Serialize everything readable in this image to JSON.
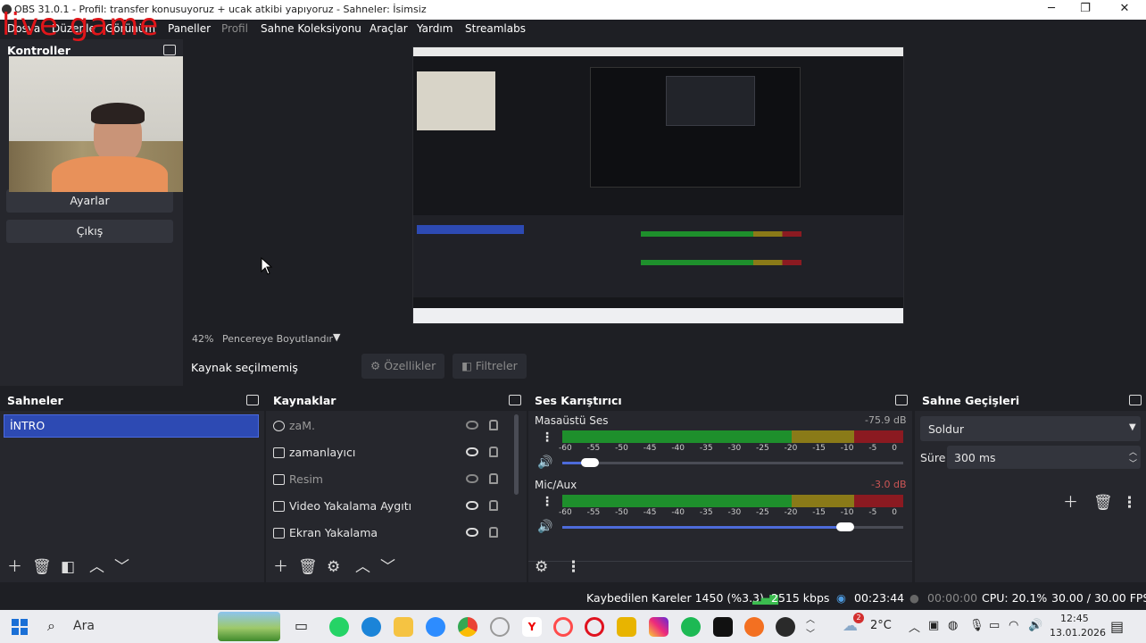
{
  "window": {
    "title": "OBS 31.0.1 - Profil: transfer  konusuyoruz + ucak atkibi yapıyoruz - Sahneler: İsimsiz",
    "minimize": "─",
    "maximize": "❐",
    "close": "✕"
  },
  "menu": {
    "items": [
      "Dosya",
      "Düzenle",
      "Görünüm",
      "Paneller",
      "Profil",
      "Sahne Koleksiyonu",
      "Araçlar",
      "Yardım",
      "Streamlabs"
    ]
  },
  "overlay_text": "live game",
  "controls": {
    "title": "Kontroller",
    "settings_label": "Ayarlar",
    "exit_label": "Çıkış"
  },
  "preview": {
    "zoom": "42%",
    "fit_label": "Pencereye Boyutlandır"
  },
  "props": {
    "no_source": "Kaynak seçilmemiş",
    "properties_label": "Özellikler",
    "filters_label": "Filtreler"
  },
  "scenes": {
    "title": "Sahneler",
    "items": [
      "İNTRO"
    ]
  },
  "sources": {
    "title": "Kaynaklar",
    "items": [
      {
        "label": "zaM.",
        "icon": "clock-icon",
        "visible": false
      },
      {
        "label": "zamanlayıcı",
        "icon": "text-icon",
        "visible": true
      },
      {
        "label": "Resim",
        "icon": "image-icon",
        "visible": false
      },
      {
        "label": "Video Yakalama Aygıtı",
        "icon": "camera-icon",
        "visible": true
      },
      {
        "label": "Ekran Yakalama",
        "icon": "monitor-icon",
        "visible": true
      }
    ]
  },
  "mixer": {
    "title": "Ses Karıştırıcı",
    "ticks": [
      "-60",
      "-55",
      "-50",
      "-45",
      "-40",
      "-35",
      "-30",
      "-25",
      "-20",
      "-15",
      "-10",
      "-5",
      "0"
    ],
    "channels": [
      {
        "name": "Masaüstü Ses",
        "db": "-75.9 dB",
        "volume": 0.08
      },
      {
        "name": "Mic/Aux",
        "db": "-3.0 dB",
        "volume": 0.83
      }
    ]
  },
  "transitions": {
    "title": "Sahne Geçişleri",
    "selected": "Soldur",
    "duration_label": "Süre",
    "duration_value": "300 ms"
  },
  "status": {
    "dropped_frames": "Kaybedilen Kareler 1450 (%3.3)",
    "bitrate": "2515 kbps",
    "stream_time": "00:23:44",
    "record_time": "00:00:00",
    "cpu": "CPU: 20.1%",
    "fps": "30.00 / 30.00 FPS"
  },
  "taskbar": {
    "search_label": "Ara",
    "temperature": "2°C",
    "time": "12:45",
    "date": "13.01.2026",
    "notification_count": "2"
  },
  "colors": {
    "accent": "#2d4ab3",
    "meter_green": "#1e8f2c",
    "meter_yellow": "#8a7a18",
    "meter_red": "#8b1a21",
    "overlay_red": "#e0161a"
  }
}
